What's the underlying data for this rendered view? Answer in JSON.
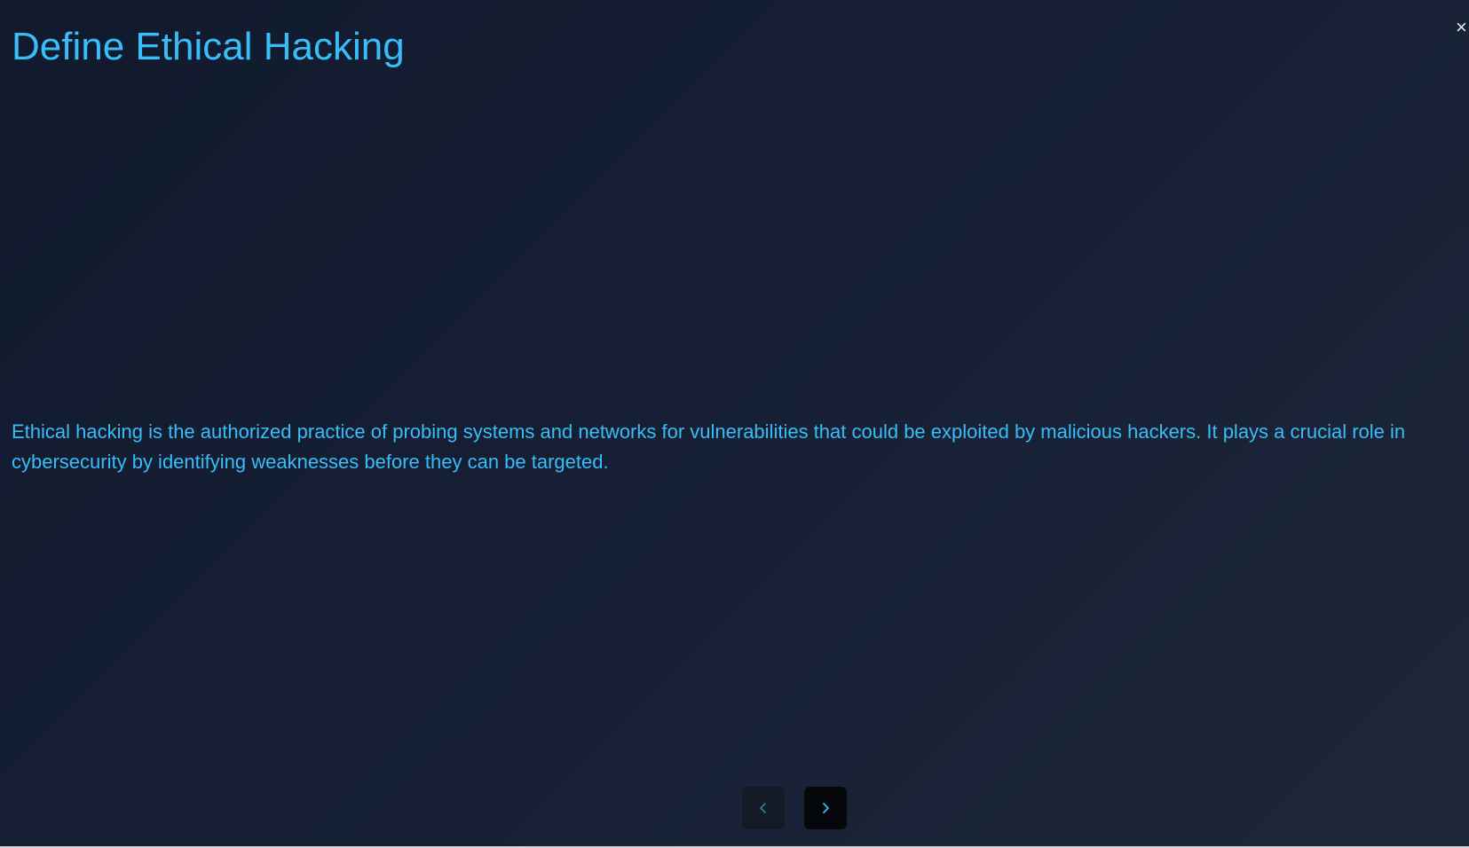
{
  "slide": {
    "title": "Define Ethical Hacking",
    "body": "Ethical hacking is the authorized practice of probing systems and networks for vulnerabilities that could be exploited by malicious hackers. It plays a crucial role in cybersecurity by identifying weaknesses before they can be targeted."
  },
  "controls": {
    "close_glyph": "×",
    "prev_icon": "chevron-left-icon",
    "next_icon": "chevron-right-icon"
  },
  "colors": {
    "accent": "#38bdf8",
    "background_start": "#111a2d",
    "background_end": "#1e2739",
    "prev_button": "#151b26",
    "next_button": "#05070b"
  }
}
